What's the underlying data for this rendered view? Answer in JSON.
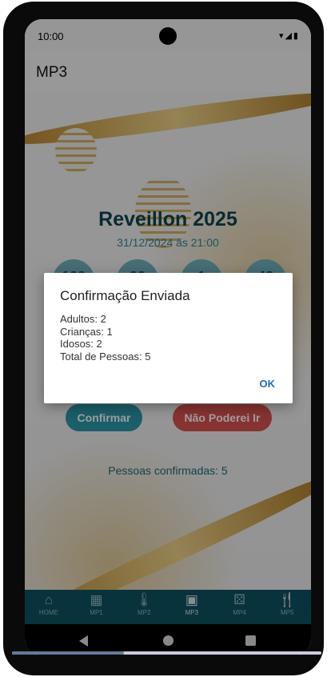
{
  "status": {
    "time": "10:00"
  },
  "appbar": {
    "title": "MP3"
  },
  "event": {
    "title": "Reveillon 2025",
    "datetime": "31/12/2024 às 21:00",
    "countdown": [
      "128",
      "23",
      "1",
      "48"
    ]
  },
  "buttons": {
    "confirm": "Confirmar",
    "decline": "Não Poderei Ir"
  },
  "confirmed": "Pessoas confirmadas: 5",
  "dialog": {
    "title": "Confirmação Enviada",
    "lines": [
      "Adultos: 2",
      "Crianças: 1",
      "Idosos: 2",
      "Total de Pessoas: 5"
    ],
    "ok": "OK"
  },
  "nav": [
    {
      "label": "HOME",
      "icon": "home-icon"
    },
    {
      "label": "MP1",
      "icon": "calculator-icon"
    },
    {
      "label": "MP2",
      "icon": "thermometer-icon"
    },
    {
      "label": "MP3",
      "icon": "calendar-icon",
      "active": true
    },
    {
      "label": "MP4",
      "icon": "dice-icon"
    },
    {
      "label": "MP5",
      "icon": "restaurant-icon"
    }
  ],
  "colors": {
    "primary": "#0e5363",
    "confirm": "#2a9aab",
    "decline": "#d9534f",
    "dialog_button": "#1d6fb0"
  }
}
